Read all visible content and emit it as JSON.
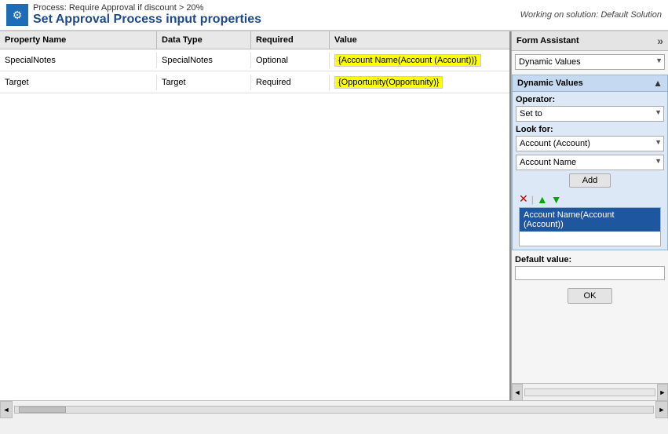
{
  "topBar": {
    "processText": "Process: Require Approval if discount > 20%",
    "title": "Set Approval Process input properties",
    "workingOn": "Working on solution: Default Solution",
    "gearIcon": "⚙"
  },
  "table": {
    "columns": [
      "Property Name",
      "Data Type",
      "Required",
      "Value"
    ],
    "rows": [
      {
        "propertyName": "SpecialNotes",
        "dataType": "SpecialNotes",
        "required": "Optional",
        "value": "{Account Name(Account (Account))}"
      },
      {
        "propertyName": "Target",
        "dataType": "Target",
        "required": "Required",
        "value": "{Opportunity(Opportunity)}"
      }
    ]
  },
  "formAssistant": {
    "title": "Form Assistant",
    "chevronIcon": "»",
    "dynamicValuesLabel": "Dynamic Values",
    "dynamicValuesSectionLabel": "Dynamic Values",
    "chevronUpIcon": "▲",
    "operatorLabel": "Operator:",
    "operatorValue": "Set to",
    "lookForLabel": "Look for:",
    "lookForValue": "Account (Account)",
    "fieldValue": "Account Name",
    "addButtonLabel": "Add",
    "removeIcon": "✕",
    "upArrowIcon": "▲",
    "downArrowIcon": "▼",
    "selectedItem": "Account Name(Account (Account))",
    "defaultValueLabel": "Default value:",
    "defaultValuePlaceholder": "",
    "okButtonLabel": "OK"
  },
  "bottomScroll": {
    "leftArrow": "◄",
    "rightArrow": "►"
  }
}
